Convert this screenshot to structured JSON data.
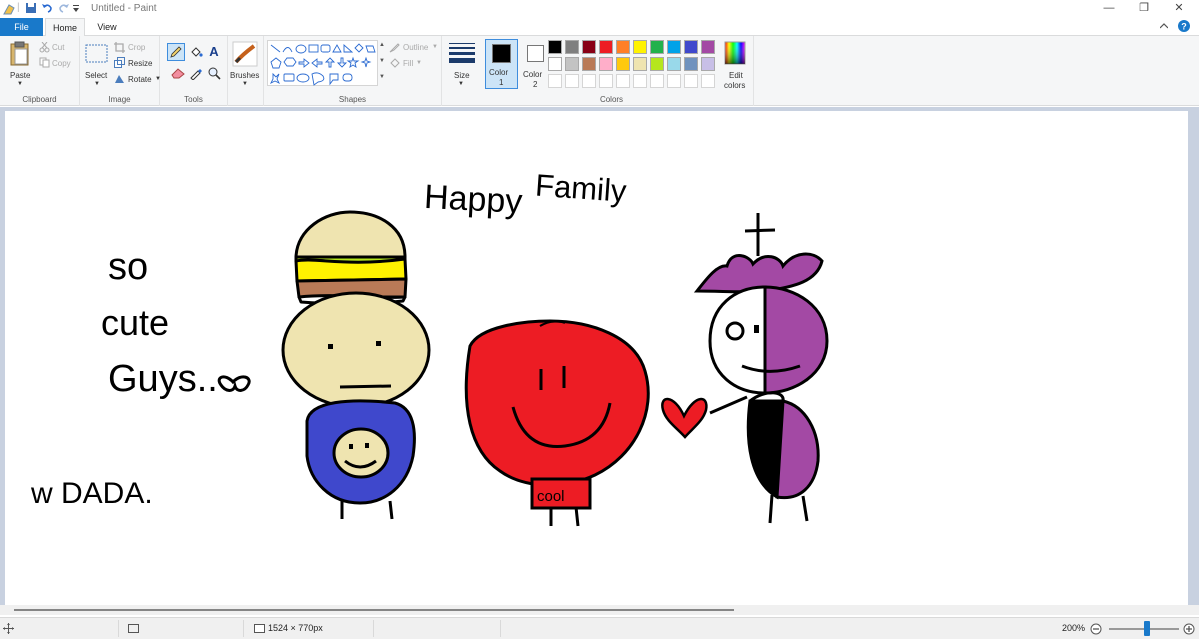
{
  "window": {
    "title": "Untitled - Paint",
    "title_separator": "|"
  },
  "tabs": {
    "file": "File",
    "home": "Home",
    "view": "View"
  },
  "ribbon": {
    "clipboard": {
      "paste": "Paste",
      "cut": "Cut",
      "copy": "Copy",
      "group": "Clipboard"
    },
    "image": {
      "select": "Select",
      "crop": "Crop",
      "resize": "Resize",
      "rotate": "Rotate",
      "group": "Image"
    },
    "tools": {
      "group": "Tools"
    },
    "brushes": {
      "label": "Brushes"
    },
    "shapes": {
      "outline": "Outline",
      "fill": "Fill",
      "group": "Shapes"
    },
    "size": {
      "label": "Size"
    },
    "colors": {
      "color1": "Color",
      "color1_num": "1",
      "color2": "Color",
      "color2_num": "2",
      "edit": "Edit",
      "edit2": "colors",
      "group": "Colors",
      "color1_value": "#000000",
      "color2_value": "#ffffff",
      "palette_row1": [
        "#000000",
        "#7f7f7f",
        "#880015",
        "#ed1c24",
        "#ff7f27",
        "#fff200",
        "#22b14c",
        "#00a2e8",
        "#3f48cc",
        "#a349a4"
      ],
      "palette_row2": [
        "#ffffff",
        "#c3c3c3",
        "#b97a57",
        "#ffaec9",
        "#ffc90e",
        "#efe4b0",
        "#b5e61d",
        "#99d9ea",
        "#7092be",
        "#c8bfe7"
      ]
    }
  },
  "drawing": {
    "text_happy": "Happy",
    "text_family": "Family",
    "text_so": "so",
    "text_cute": "cute",
    "text_guys": "Guys..",
    "text_dada": "w DADA.",
    "text_cool": "cool",
    "colors": {
      "burger_top": "#efe4b0",
      "burger_lettuce": "#b5e61d",
      "burger_cheese": "#fff200",
      "burger_patty": "#b97a57",
      "face_tan": "#efe4b0",
      "body_blue": "#3f48cc",
      "apple_red": "#ed1c24",
      "purple": "#a349a4"
    }
  },
  "status": {
    "canvas_size": "1524 × 770px",
    "zoom": "200%"
  }
}
